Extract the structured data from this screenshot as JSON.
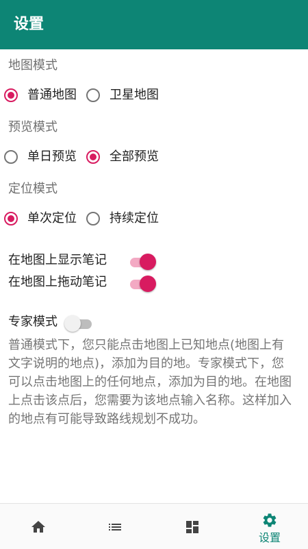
{
  "app_bar": {
    "title": "设置"
  },
  "map_mode": {
    "label": "地图模式",
    "options": [
      {
        "label": "普通地图",
        "selected": true
      },
      {
        "label": "卫星地图",
        "selected": false
      }
    ]
  },
  "preview_mode": {
    "label": "预览模式",
    "options": [
      {
        "label": "单日预览",
        "selected": false
      },
      {
        "label": "全部预览",
        "selected": true
      }
    ]
  },
  "location_mode": {
    "label": "定位模式",
    "options": [
      {
        "label": "单次定位",
        "selected": true
      },
      {
        "label": "持续定位",
        "selected": false
      }
    ]
  },
  "toggles": {
    "show_notes": {
      "label": "在地图上显示笔记",
      "on": true
    },
    "drag_notes": {
      "label": "在地图上拖动笔记",
      "on": true
    },
    "expert_mode": {
      "label": "专家模式",
      "on": false
    }
  },
  "expert_description": "普通模式下，您只能点击地图上已知地点(地图上有文字说明的地点)，添加为目的地。专家模式下，您可以点击地图上的任何地点，添加为目的地。在地图上点击该点后，您需要为该地点输入名称。这样加入的地点有可能导致路线规划不成功。",
  "bottom_nav": {
    "items": [
      {
        "icon": "home-icon",
        "label": ""
      },
      {
        "icon": "list-icon",
        "label": ""
      },
      {
        "icon": "dashboard-icon",
        "label": ""
      },
      {
        "icon": "gear-icon",
        "label": "设置",
        "active": true
      }
    ]
  },
  "colors": {
    "primary": "#0d8575",
    "accent": "#d81b60"
  }
}
